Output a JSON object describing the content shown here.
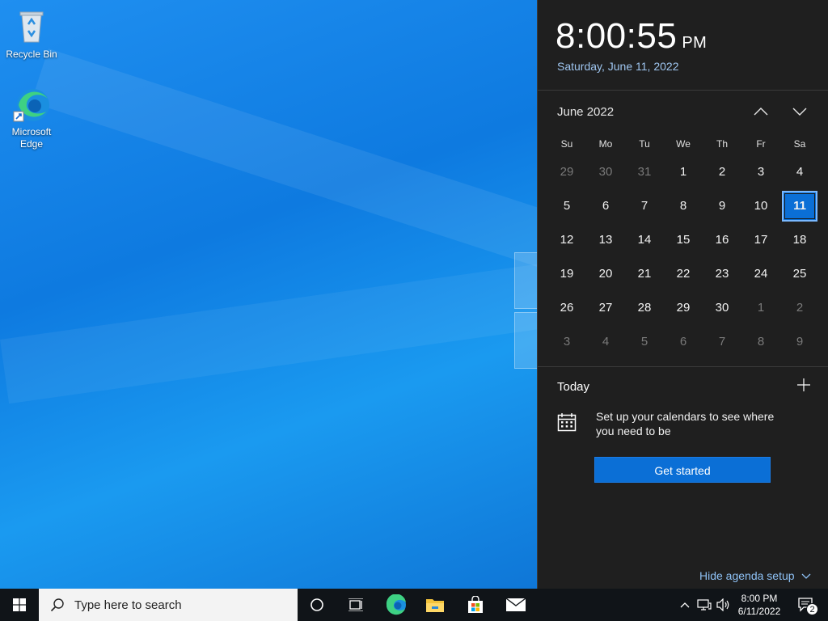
{
  "desktop": {
    "icons": [
      {
        "label": "Recycle Bin",
        "icon": "recycle-bin-icon"
      },
      {
        "label": "Microsoft Edge",
        "icon": "edge-icon"
      }
    ]
  },
  "flyout": {
    "time": "8:00:55",
    "ampm": "PM",
    "date": "Saturday, June 11, 2022",
    "month_label": "June 2022",
    "weekdays": [
      "Su",
      "Mo",
      "Tu",
      "We",
      "Th",
      "Fr",
      "Sa"
    ],
    "weeks": [
      [
        "29",
        "30",
        "31",
        "1",
        "2",
        "3",
        "4"
      ],
      [
        "5",
        "6",
        "7",
        "8",
        "9",
        "10",
        "11"
      ],
      [
        "12",
        "13",
        "14",
        "15",
        "16",
        "17",
        "18"
      ],
      [
        "19",
        "20",
        "21",
        "22",
        "23",
        "24",
        "25"
      ],
      [
        "26",
        "27",
        "28",
        "29",
        "30",
        "1",
        "2"
      ],
      [
        "3",
        "4",
        "5",
        "6",
        "7",
        "8",
        "9"
      ]
    ],
    "selected_day": "11",
    "today_label": "Today",
    "setup_text": "Set up your calendars to see where you need to be",
    "get_started": "Get started",
    "hide_agenda": "Hide agenda setup"
  },
  "taskbar": {
    "search_placeholder": "Type here to search",
    "pinned": [
      "cortana-icon",
      "task-view-icon",
      "edge-icon",
      "file-explorer-icon",
      "store-icon",
      "mail-icon"
    ],
    "clock_time": "8:00 PM",
    "clock_date": "6/11/2022",
    "notification_count": "2"
  },
  "colors": {
    "accent": "#0b6fd6",
    "flyout_bg": "#1f1f1f",
    "taskbar_bg": "#101418",
    "date_text": "#9fc6f0"
  }
}
